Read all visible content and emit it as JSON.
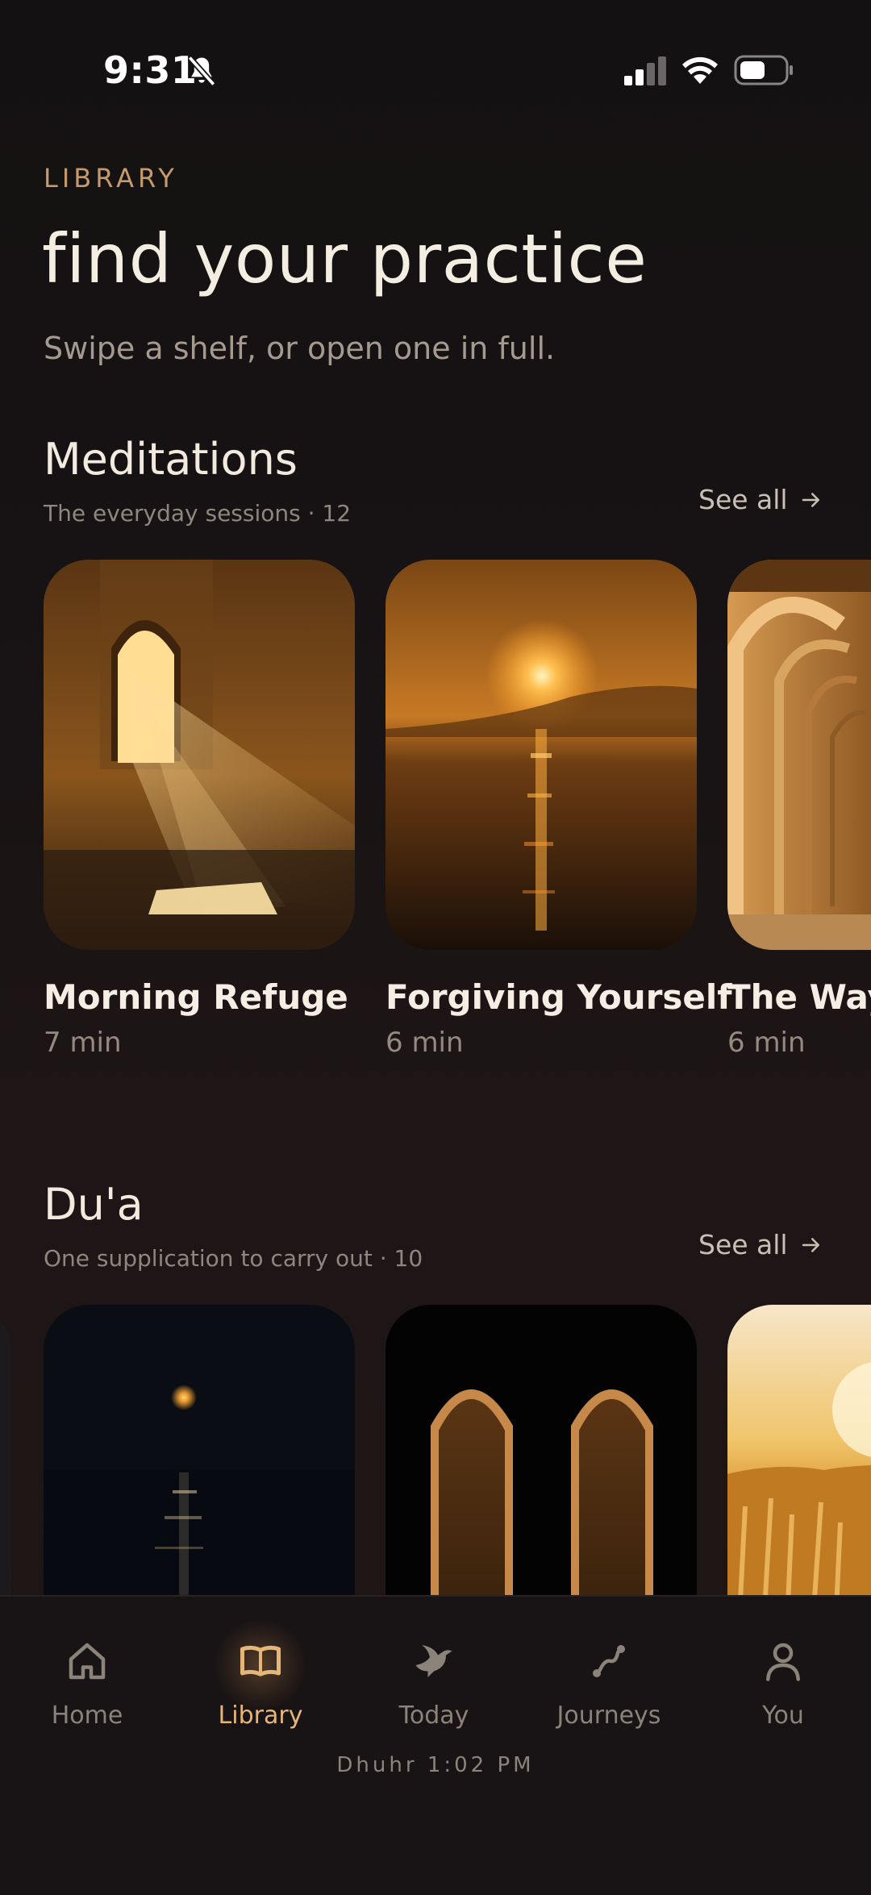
{
  "status_bar": {
    "time": "9:31",
    "silent_icon": "bell-slash-icon",
    "signal_icon": "cellular-signal-icon",
    "wifi_icon": "wifi-icon",
    "battery_icon": "battery-icon"
  },
  "header": {
    "eyebrow": "LIBRARY",
    "title": "find your practice",
    "subtitle": "Swipe a shelf, or open one in full."
  },
  "shelves": [
    {
      "title": "Meditations",
      "meta": "The everyday sessions · 12",
      "see_all": "See all",
      "cards": [
        {
          "title": "Morning Refuge",
          "duration": "7 min",
          "image": "sunlit-arch-window"
        },
        {
          "title": "Forgiving Yourself",
          "duration": "6 min",
          "image": "sunset-over-water"
        },
        {
          "title": "The Way",
          "duration": "6 min",
          "image": "arched-corridor"
        }
      ]
    },
    {
      "title": "Du'a",
      "meta": "One supplication to carry out · 10",
      "see_all": "See all",
      "cards": [
        {
          "title": "",
          "duration": "",
          "image": "moon-over-sea"
        },
        {
          "title": "",
          "duration": "",
          "image": "twin-arches"
        },
        {
          "title": "",
          "duration": "",
          "image": "wheat-field-sunrise"
        }
      ]
    }
  ],
  "nav": {
    "items": [
      {
        "label": "Home",
        "icon": "home-icon",
        "active": false
      },
      {
        "label": "Library",
        "icon": "book-icon",
        "active": true
      },
      {
        "label": "Today",
        "icon": "dove-icon",
        "active": false
      },
      {
        "label": "Journeys",
        "icon": "route-icon",
        "active": false
      },
      {
        "label": "You",
        "icon": "person-icon",
        "active": false
      }
    ],
    "prayer_time": "Dhuhr 1:02 PM"
  },
  "colors": {
    "accent": "#e6b679",
    "eyebrow": "#c79a6b",
    "background": "#141112"
  }
}
